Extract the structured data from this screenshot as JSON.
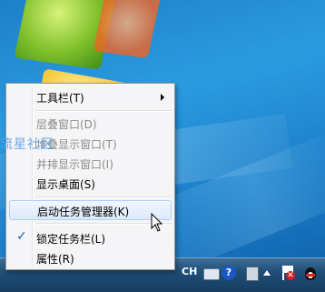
{
  "watermark": "流星社区",
  "context_menu": {
    "items": [
      {
        "label": "工具栏(T)",
        "submenu": true,
        "disabled": false
      },
      {
        "label": "层叠窗口(D)",
        "disabled": true
      },
      {
        "label": "堆叠显示窗口(T)",
        "disabled": true
      },
      {
        "label": "并排显示窗口(I)",
        "disabled": true
      },
      {
        "label": "显示桌面(S)",
        "disabled": false
      },
      {
        "label": "启动任务管理器(K)",
        "disabled": false,
        "highlighted": true
      },
      {
        "label": "锁定任务栏(L)",
        "disabled": false,
        "checked": true
      },
      {
        "label": "属性(R)",
        "disabled": false
      }
    ],
    "check_glyph": "✓"
  },
  "taskbar": {
    "tray": {
      "language": "CH",
      "help_glyph": "?",
      "icons": [
        "keyboard-icon",
        "help-icon",
        "up-down-icon",
        "show-hidden-icons",
        "action-center-flag-icon",
        "qq-penguin-icon"
      ]
    }
  },
  "colors": {
    "menu_bg": "#f5f5f7",
    "highlight_border": "#aecff7",
    "taskbar": "#1f4e78"
  }
}
